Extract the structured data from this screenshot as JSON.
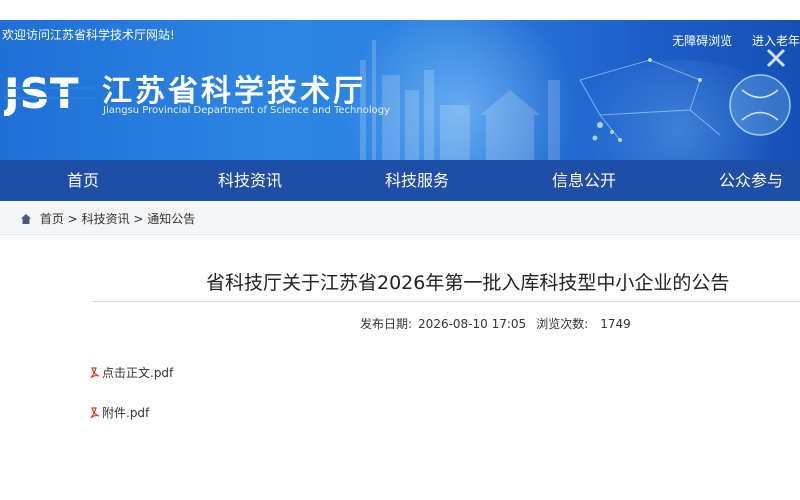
{
  "header": {
    "welcome": "欢迎访问江苏省科学技术厅网站!",
    "accessibility_link": "无障碍浏览",
    "elder_link": "进入老年",
    "logo_text": "JST",
    "site_title": "江苏省科学技术厅",
    "site_subtitle": "Jiangsu Provincial Department of Science and Technology"
  },
  "nav": {
    "items": [
      {
        "label": "首页"
      },
      {
        "label": "科技资讯"
      },
      {
        "label": "科技服务"
      },
      {
        "label": "信息公开"
      },
      {
        "label": "公众参与"
      }
    ]
  },
  "breadcrumb": {
    "home": "首页",
    "sep": ">",
    "level1": "科技资讯",
    "level2": "通知公告"
  },
  "article": {
    "title": "省科技厅关于江苏省2026年第一批入库科技型中小企业的公告",
    "publish_label": "发布日期:",
    "publish_date": "2026-08-10 17:05",
    "views_label": "浏览次数:",
    "views_count": "1749",
    "attachments": [
      {
        "name": "点击正文.pdf"
      },
      {
        "name": "附件.pdf"
      }
    ]
  },
  "colors": {
    "nav_bg": "#1e4ea5",
    "banner_start": "#1f6fd6",
    "banner_end": "#1550b6",
    "pdf_icon": "#d9412b"
  },
  "icons": {
    "home": "home-icon",
    "pdf": "pdf-icon"
  }
}
